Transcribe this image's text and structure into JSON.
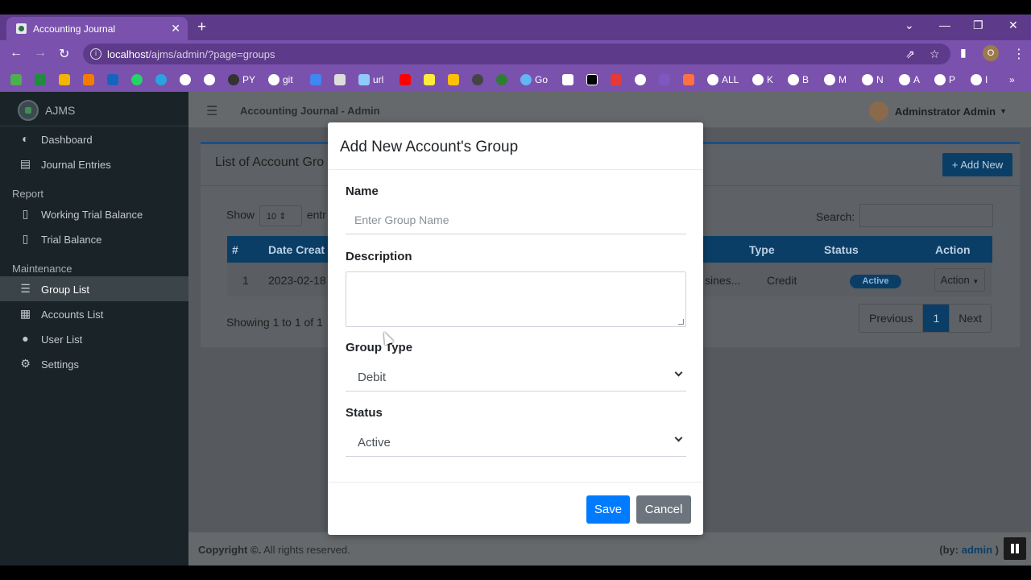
{
  "browser": {
    "tab_title": "Accounting Journal",
    "tab_close": "✕",
    "new_tab": "+",
    "url_host": "localhost",
    "url_path": "/ajms/admin/?page=groups",
    "profile_initial": "O",
    "window_controls": [
      "⌄",
      "—",
      "❐",
      "✕"
    ],
    "bookmarks": [
      "PY",
      "git",
      "url",
      "Go",
      "ALL",
      "K",
      "B",
      "M",
      "N",
      "A",
      "P",
      "I"
    ],
    "more": "»"
  },
  "sidebar": {
    "brand": "AJMS",
    "items": [
      {
        "label": "Dashboard",
        "icon": "dashboard-icon"
      },
      {
        "label": "Journal Entries",
        "icon": "book-icon"
      }
    ],
    "report_header": "Report",
    "report_items": [
      {
        "label": "Working Trial Balance",
        "icon": "file-icon"
      },
      {
        "label": "Trial Balance",
        "icon": "file-icon"
      }
    ],
    "maintenance_header": "Maintenance",
    "maintenance_items": [
      {
        "label": "Group List",
        "icon": "list-icon"
      },
      {
        "label": "Accounts List",
        "icon": "table-icon"
      },
      {
        "label": "User List",
        "icon": "users-icon"
      },
      {
        "label": "Settings",
        "icon": "gears-icon"
      }
    ]
  },
  "topbar": {
    "title": "Accounting Journal - Admin",
    "user": "Adminstrator Admin"
  },
  "card": {
    "title": "List of Account Gro",
    "add_new": "Add New",
    "show_label": "Show",
    "show_value": "10",
    "entries_label": "entr",
    "search_label": "Search:",
    "headers": [
      "#",
      "Date Creat",
      "Type",
      "Status",
      "Action"
    ],
    "row": {
      "num": "1",
      "date": "2023-02-18",
      "desc": "sines...",
      "type": "Credit",
      "status": "Active",
      "action": "Action"
    },
    "showing": "Showing 1 to 1 of 1",
    "pager": {
      "prev": "Previous",
      "current": "1",
      "next": "Next"
    }
  },
  "footer": {
    "copyright": "Copyright ©.",
    "rights": "All rights reserved.",
    "by": "(by:",
    "admin": "admin",
    "close": ")"
  },
  "modal": {
    "title": "Add New Account's Group",
    "name_label": "Name",
    "name_placeholder": "Enter Group Name",
    "description_label": "Description",
    "group_type_label": "Group Type",
    "group_type_value": "Debit",
    "status_label": "Status",
    "status_value": "Active",
    "save": "Save",
    "cancel": "Cancel"
  },
  "colors": {
    "browser_accent": "#7a52ad",
    "primary": "#007bff",
    "secondary": "#6c757d"
  }
}
